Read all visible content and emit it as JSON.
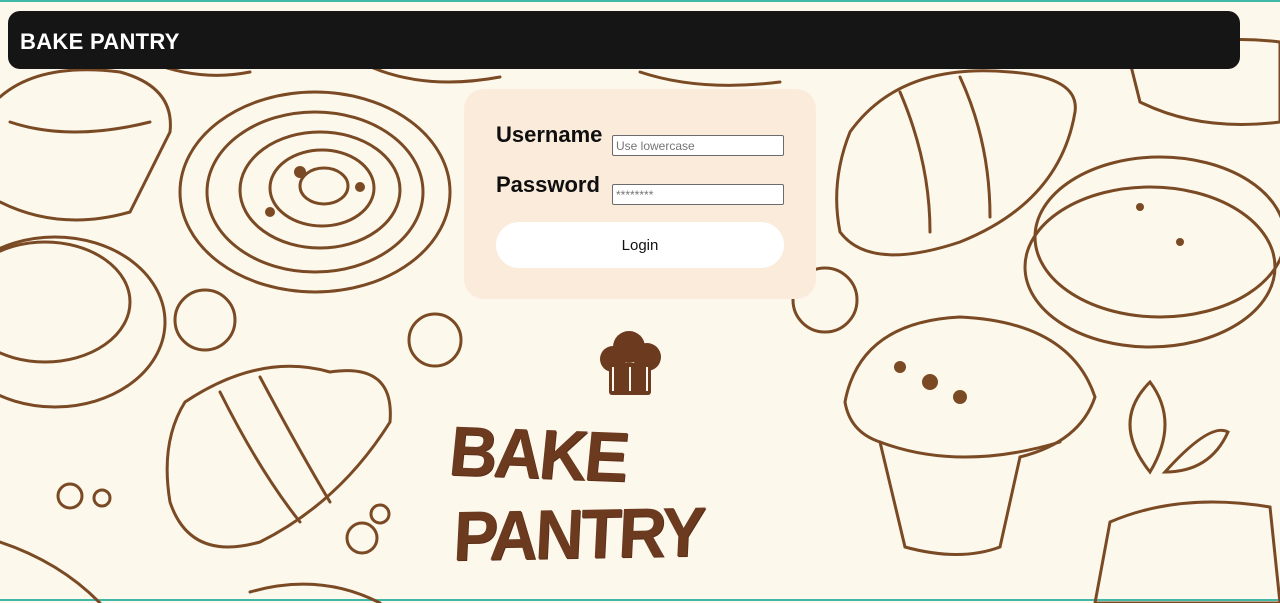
{
  "header": {
    "brand": "BAKE PANTRY"
  },
  "login": {
    "username_label": "Username",
    "username_placeholder": "Use lowercase",
    "password_label": "Password",
    "password_placeholder": "********",
    "submit_label": "Login"
  },
  "logo": {
    "word_left": "BAKE",
    "word_right": "PANTRY"
  },
  "colors": {
    "header_bg": "#151515",
    "card_bg": "#faebdb",
    "illustration": "#7a4a24",
    "page_bg": "#fdf8ec"
  }
}
